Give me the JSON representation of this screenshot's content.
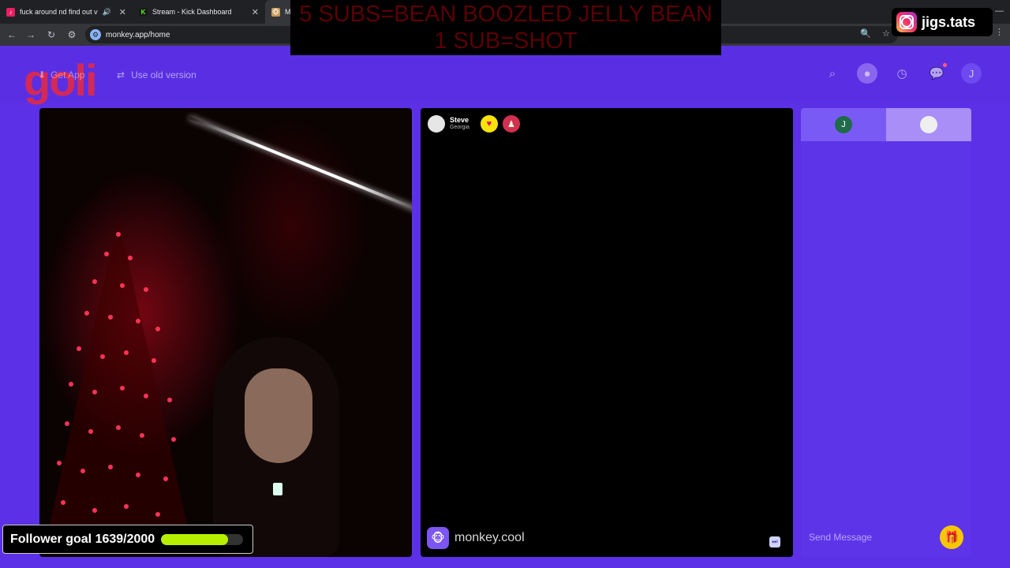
{
  "browser": {
    "tabs": [
      {
        "title": "fuck around nd find out vol",
        "favicon_color": "#e91e63",
        "playing_audio": true
      },
      {
        "title": "Stream - Kick Dashboard",
        "favicon_color": "#53fc18",
        "favicon_letter": "K"
      },
      {
        "title": "M",
        "favicon": "monkey-icon",
        "active": true
      }
    ],
    "url": "monkey.app/home"
  },
  "overlay": {
    "banner_line1": "5 SUBS=BEAN BOOZLED JELLY BEAN",
    "banner_line2": "1 SUB=SHOT",
    "instagram_handle": "jigs.tats",
    "follower_goal": {
      "label": "Follower goal 1639/2000",
      "current": 1639,
      "target": 2000,
      "fill_color": "#b6f000"
    }
  },
  "header": {
    "logo_text": "goli",
    "get_app": "Get App",
    "old_version": "Use old version",
    "user_initial": "J"
  },
  "peer": {
    "name": "Steve",
    "location": "Georgia"
  },
  "brand": {
    "text": "monkey.cool"
  },
  "chat": {
    "tab_left_initial": "J",
    "placeholder": "Send Message"
  },
  "colors": {
    "background": "#5b30e6",
    "chat_bg": "#5e34e8",
    "banner_text": "#5a0005"
  }
}
